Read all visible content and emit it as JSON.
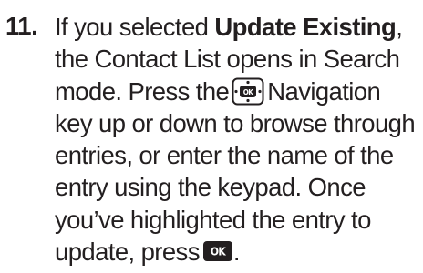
{
  "step": {
    "number": "11.",
    "lines": {
      "l1_prefix": "If you selected ",
      "l1_bold": "Update Existing",
      "l1_suffix": ",",
      "l2": "the Contact List opens in Search",
      "l3_prefix": "mode. Press the",
      "l3_suffix": "Navigation",
      "l4": "key up or down to browse through",
      "l5": "entries, or enter the name of the",
      "l6": "entry using the keypad. Once",
      "l7": "you’ve highlighted the entry to",
      "l8_prefix": "update, press",
      "l8_suffix": "."
    },
    "icons": {
      "navigation_key": "navigation-key-icon",
      "ok_key": "ok-key-icon",
      "key_label": "OK",
      "key_color": "#231f20"
    }
  }
}
